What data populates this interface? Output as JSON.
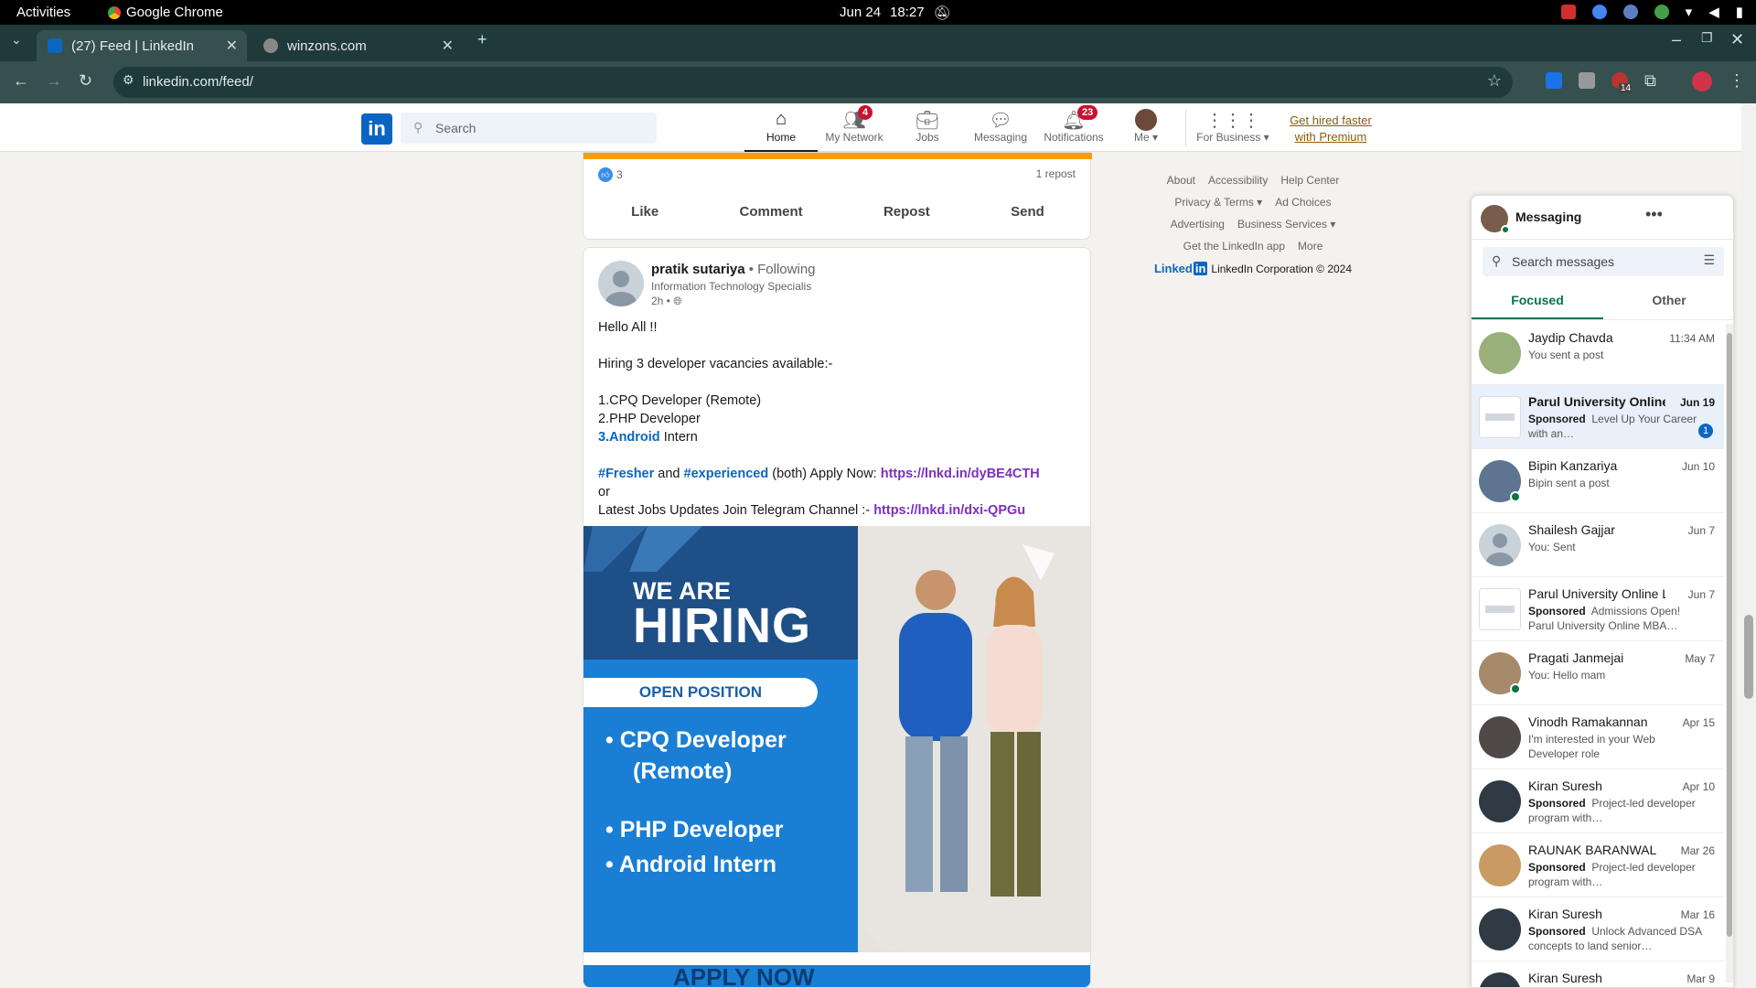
{
  "system": {
    "activities": "Activities",
    "app_name": "Google Chrome",
    "date": "Jun 24",
    "time": "18:27"
  },
  "browser": {
    "tabs": [
      {
        "title": "(27) Feed | LinkedIn",
        "active": true
      },
      {
        "title": "winzons.com",
        "active": false
      }
    ],
    "url": "linkedin.com/feed/",
    "extension_badge": "14"
  },
  "nav": {
    "search_placeholder": "Search",
    "items": [
      {
        "label": "Home",
        "icon": "home-icon",
        "badge": ""
      },
      {
        "label": "My Network",
        "icon": "network-icon",
        "badge": "4"
      },
      {
        "label": "Jobs",
        "icon": "briefcase-icon",
        "badge": ""
      },
      {
        "label": "Messaging",
        "icon": "chat-icon",
        "badge": ""
      },
      {
        "label": "Notifications",
        "icon": "bell-icon",
        "badge": "23"
      },
      {
        "label": "Me",
        "icon": "avatar-icon",
        "badge": ""
      },
      {
        "label": "For Business",
        "icon": "grid-icon",
        "badge": ""
      }
    ],
    "premium_line1": "Get hired faster",
    "premium_line2": "with Premium"
  },
  "prev_post": {
    "reaction_count": "3",
    "reposts": "1 repost",
    "actions": [
      "Like",
      "Comment",
      "Repost",
      "Send"
    ]
  },
  "post": {
    "author": "pratik sutariya",
    "follow_status": "• Following",
    "headline": "Information Technology Specialis",
    "time": "2h •",
    "line1": "Hello All !!",
    "line2": "Hiring 3 developer vacancies available:-",
    "item1": "1.CPQ Developer (Remote)",
    "item2": "2.PHP Developer",
    "item3_link": "3.Android",
    "item3_rest": " Intern",
    "tag1": "#Fresher",
    "and": " and ",
    "tag2": "#experienced",
    "apply_text": " (both) Apply Now: ",
    "apply_link": "https://lnkd.in/dyBE4CTH",
    "or": "or",
    "telegram_text": "Latest Jobs Updates Join Telegram Channel :- ",
    "telegram_link": "https://lnkd.in/dxi-QPGu",
    "image": {
      "we_are": "WE ARE",
      "hiring": "HIRING",
      "open_position": "OPEN POSITION",
      "pos1a": "• CPQ Developer",
      "pos1b": "(Remote)",
      "pos2": "• PHP Developer",
      "pos3": "• Android Intern",
      "apply": "APPLY NOW"
    }
  },
  "footer": {
    "row1": [
      "About",
      "Accessibility",
      "Help Center"
    ],
    "row2": [
      "Privacy & Terms ▾",
      "Ad Choices"
    ],
    "row3": [
      "Advertising",
      "Business Services ▾"
    ],
    "row4": [
      "Get the LinkedIn app",
      "More"
    ],
    "brand": "Linked",
    "brand_in": "in",
    "corp": "LinkedIn Corporation © 2024"
  },
  "messaging": {
    "title": "Messaging",
    "search_placeholder": "Search messages",
    "tabs": [
      "Focused",
      "Other"
    ],
    "conversations": [
      {
        "name": "Jaydip Chavda",
        "date": "11:34 AM",
        "sponsored": "",
        "preview": "You sent a post",
        "highlight": false,
        "online": false,
        "logo": false
      },
      {
        "name": "Parul University Online",
        "date": "Jun 19",
        "sponsored": "Sponsored",
        "preview": "Level Up Your Career with an…",
        "highlight": true,
        "online": false,
        "logo": true,
        "unread": "1"
      },
      {
        "name": "Bipin Kanzariya",
        "date": "Jun 10",
        "sponsored": "",
        "preview": "Bipin sent a post",
        "highlight": false,
        "online": true,
        "logo": false
      },
      {
        "name": "Shailesh Gajjar",
        "date": "Jun 7",
        "sponsored": "",
        "preview": "You: Sent",
        "highlight": false,
        "online": false,
        "logo": false
      },
      {
        "name": "Parul University Online Le",
        "date": "Jun 7",
        "sponsored": "Sponsored",
        "preview": "Admissions Open! Parul University Online MBA…",
        "highlight": false,
        "online": false,
        "logo": true
      },
      {
        "name": "Pragati Janmejai",
        "date": "May 7",
        "sponsored": "",
        "preview": "You: Hello mam",
        "highlight": false,
        "online": true,
        "logo": false
      },
      {
        "name": "Vinodh Ramakannan",
        "date": "Apr 15",
        "sponsored": "",
        "preview": "I'm interested in your Web Developer role",
        "highlight": false,
        "online": false,
        "logo": false
      },
      {
        "name": "Kiran Suresh",
        "date": "Apr 10",
        "sponsored": "Sponsored",
        "preview": "Project-led developer program with…",
        "highlight": false,
        "online": false,
        "logo": false
      },
      {
        "name": "RAUNAK BARANWAL",
        "date": "Mar 26",
        "sponsored": "Sponsored",
        "preview": "Project-led developer program with…",
        "highlight": false,
        "online": false,
        "logo": false
      },
      {
        "name": "Kiran Suresh",
        "date": "Mar 16",
        "sponsored": "Sponsored",
        "preview": "Unlock Advanced DSA concepts to land senior…",
        "highlight": false,
        "online": false,
        "logo": false
      },
      {
        "name": "Kiran Suresh",
        "date": "Mar 9",
        "sponsored": "",
        "preview": "",
        "highlight": false,
        "online": false,
        "logo": false
      }
    ]
  },
  "colors": {
    "linkedin_blue": "#0a66c2",
    "focused_green": "#01754f",
    "badge_red": "#cb112d",
    "hashtag_purple": "#7b2fbf"
  }
}
